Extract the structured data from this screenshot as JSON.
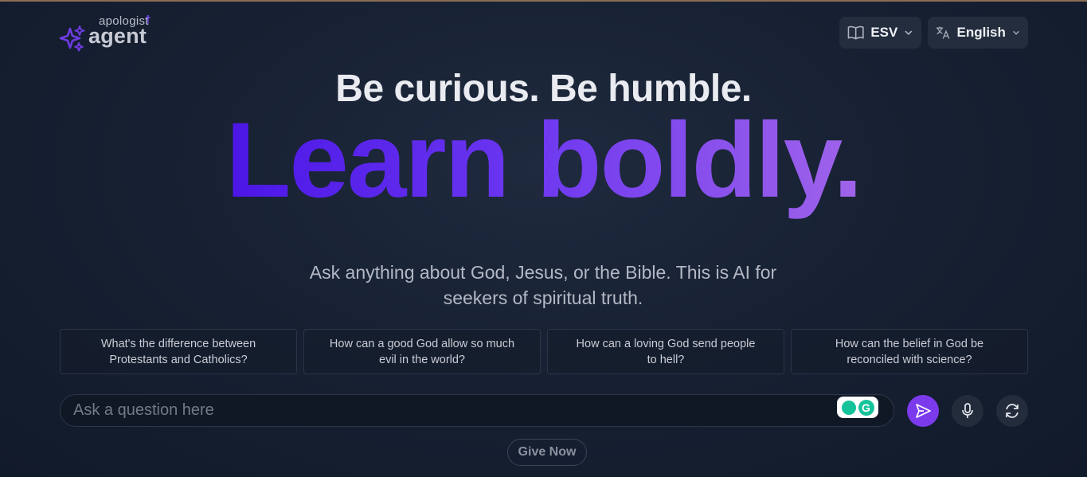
{
  "logo": {
    "top_text": "apologist",
    "cross": "†",
    "main_text": "agent"
  },
  "selectors": {
    "bible_version": "ESV",
    "language": "English"
  },
  "hero": {
    "headline": "Be curious. Be humble.",
    "tagline": "Learn boldly.",
    "subtitle": "Ask anything about God, Jesus, or the Bible. This is AI for seekers of spiritual truth."
  },
  "suggestions": [
    "What's the difference between Protestants and Catholics?",
    "How can a good God allow so much evil in the world?",
    "How can a loving God send people to hell?",
    "How can the belief in God be reconciled with science?"
  ],
  "input": {
    "placeholder": "Ask a question here"
  },
  "grammarly": {
    "letter": "G"
  },
  "donate": {
    "label": "Give Now"
  },
  "colors": {
    "accent": "#7c3aed",
    "gradient_start": "#4b16e6",
    "gradient_end": "#a064ea"
  }
}
